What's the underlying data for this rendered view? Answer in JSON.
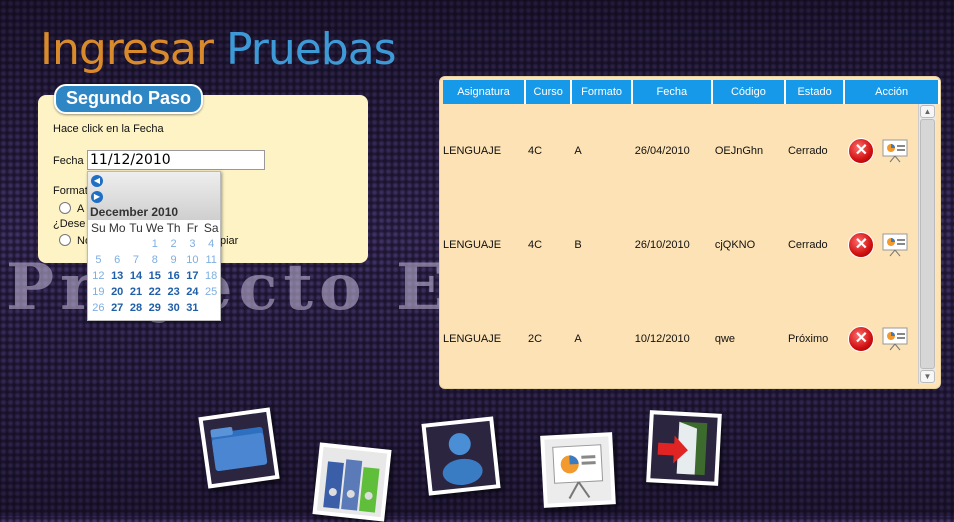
{
  "header": {
    "title_part1": "Ingresar",
    "title_part2": "Pruebas"
  },
  "watermark": "Proyecto Ed",
  "step": {
    "badge": "Segundo Paso",
    "instruction": "Hace click en la Fecha",
    "date_label": "Fecha",
    "date_value": "11/12/2010",
    "formato_label": "Formato",
    "option_a": "A",
    "desea_label": "¿Dese",
    "option_no": "No",
    "copiar_tail": "piar"
  },
  "calendar": {
    "title": "December 2010",
    "prev_icon": "prev-arrow-icon",
    "next_icon": "next-arrow-icon",
    "weekdays": [
      "Su",
      "Mo",
      "Tu",
      "We",
      "Th",
      "Fr",
      "Sa"
    ],
    "weeks": [
      [
        "",
        "",
        "",
        "1",
        "2",
        "3",
        "4"
      ],
      [
        "5",
        "6",
        "7",
        "8",
        "9",
        "10",
        "11"
      ],
      [
        "12",
        "13",
        "14",
        "15",
        "16",
        "17",
        "18"
      ],
      [
        "19",
        "20",
        "21",
        "22",
        "23",
        "24",
        "25"
      ],
      [
        "26",
        "27",
        "28",
        "29",
        "30",
        "31",
        ""
      ]
    ],
    "highlighted_days": [
      "13",
      "14",
      "15",
      "16",
      "17",
      "20",
      "21",
      "22",
      "23",
      "24",
      "27",
      "28",
      "29",
      "30",
      "31"
    ]
  },
  "table": {
    "columns": [
      "Asignatura",
      "Curso",
      "Formato",
      "Fecha",
      "Código",
      "Estado",
      "Acción"
    ],
    "rows": [
      {
        "asignatura": "LENGUAJE",
        "curso": "4C",
        "formato": "A",
        "fecha": "26/04/2010",
        "codigo": "OEJnGhn",
        "estado": "Cerrado"
      },
      {
        "asignatura": "LENGUAJE",
        "curso": "4C",
        "formato": "B",
        "fecha": "26/10/2010",
        "codigo": "cjQKNO",
        "estado": "Cerrado"
      },
      {
        "asignatura": "LENGUAJE",
        "curso": "2C",
        "formato": "A",
        "fecha": "10/12/2010",
        "codigo": "qwe",
        "estado": "Próximo"
      }
    ],
    "delete_icon": "delete-icon",
    "view_icon": "presentation-icon"
  },
  "dock": {
    "items": [
      {
        "icon": "folder-icon"
      },
      {
        "icon": "binders-icon"
      },
      {
        "icon": "user-icon"
      },
      {
        "icon": "presentation-icon"
      },
      {
        "icon": "exit-door-icon"
      }
    ]
  },
  "colors": {
    "header_blue": "#1599e8",
    "panel_cream": "#fdf3c5",
    "grid_bg": "#fce2b4",
    "title_orange": "#d98a2b",
    "title_blue": "#3d9ad6"
  }
}
